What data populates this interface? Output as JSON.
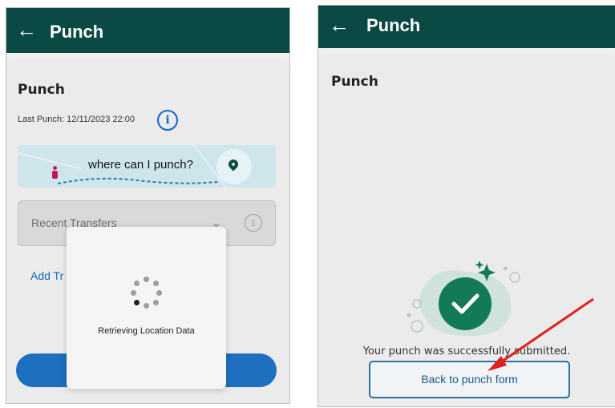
{
  "left": {
    "topbar": {
      "back_icon": "arrow-left-icon",
      "title": "Punch"
    },
    "card_title": "Punch",
    "last_punch": "Last Punch: 12/11/2023 22:00",
    "banner": {
      "text": "where can I punch?",
      "icon": "location-pin-icon"
    },
    "recent_transfers": {
      "label": "Recent Transfers"
    },
    "add_transfer_partial": "Add Tr",
    "modal": {
      "text": "Retrieving Location Data"
    }
  },
  "right": {
    "topbar": {
      "back_icon": "arrow-left-icon",
      "title": "Punch"
    },
    "card_title": "Punch",
    "success_message": "Your punch was successfully submitted.",
    "back_button": "Back to punch form"
  },
  "colors": {
    "header": "#0b4a44",
    "link": "#1565c0",
    "success": "#137a5a",
    "annotation_arrow": "#e02020"
  }
}
